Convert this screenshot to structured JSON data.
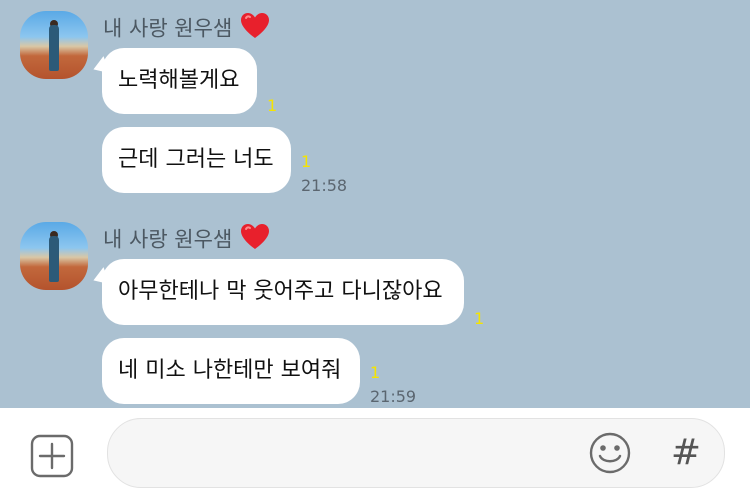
{
  "messages": [
    {
      "sender": "내 사랑 원우샘",
      "bubbles": [
        {
          "text": "노력해볼게요",
          "unread": "1"
        },
        {
          "text": "근데 그러는 너도",
          "unread": "1"
        }
      ],
      "time": "21:58"
    },
    {
      "sender": "내 사랑 원우샘",
      "bubbles": [
        {
          "text": "아무한테나 막 웃어주고 다니잖아요",
          "unread": "1"
        },
        {
          "text": "네 미소 나한테만 보여줘",
          "unread": "1"
        }
      ],
      "time": "21:59"
    }
  ],
  "input": {
    "placeholder": "",
    "value": "",
    "attach_icon": "plus-square-icon",
    "emoji_icon": "smiley-icon",
    "hashtag_label": "#"
  },
  "colors": {
    "chat_background": "#abc1d1",
    "bubble": "#ffffff",
    "unread": "#f5e400",
    "heart": "#e8202c"
  }
}
